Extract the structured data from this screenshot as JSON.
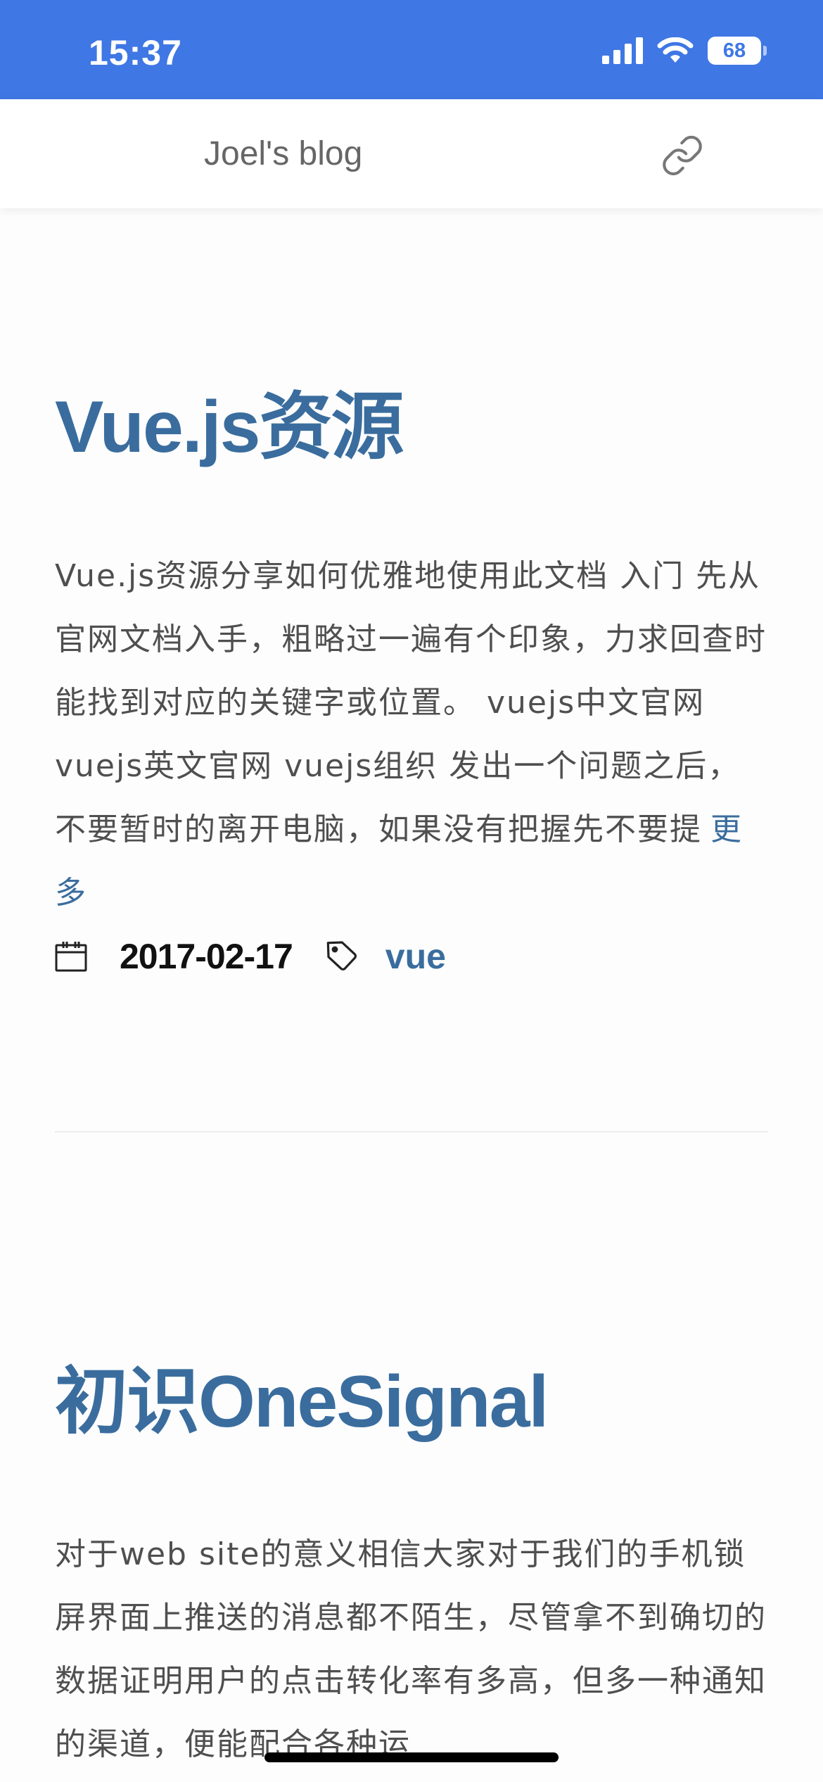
{
  "status_bar": {
    "time": "15:37",
    "battery": "68"
  },
  "navbar": {
    "brand": "Joel's blog",
    "link_icon": "link-icon"
  },
  "posts": [
    {
      "title": "Vue.js资源",
      "excerpt": "Vue.js资源分享如何优雅地使用此文档 入门 先从官网文档入手，粗略过一遍有个印象，力求回查时能找到对应的关键字或位置。 vuejs中文官网 vuejs英文官网 vuejs组织 发出一个问题之后，不要暂时的离开电脑，如果没有把握先不要提",
      "more": "更多",
      "date": "2017-02-17",
      "tag": "vue"
    },
    {
      "title": "初识OneSignal",
      "excerpt": "对于web site的意义相信大家对于我们的手机锁屏界面上推送的消息都不陌生，尽管拿不到确切的数据证明用户的点击转化率有多高，但多一种通知的渠道，便能配合各种运"
    }
  ],
  "colors": {
    "status_bar": "#3f77e4",
    "accent": "#3a6d9e",
    "body_text": "#4f4f4f"
  }
}
